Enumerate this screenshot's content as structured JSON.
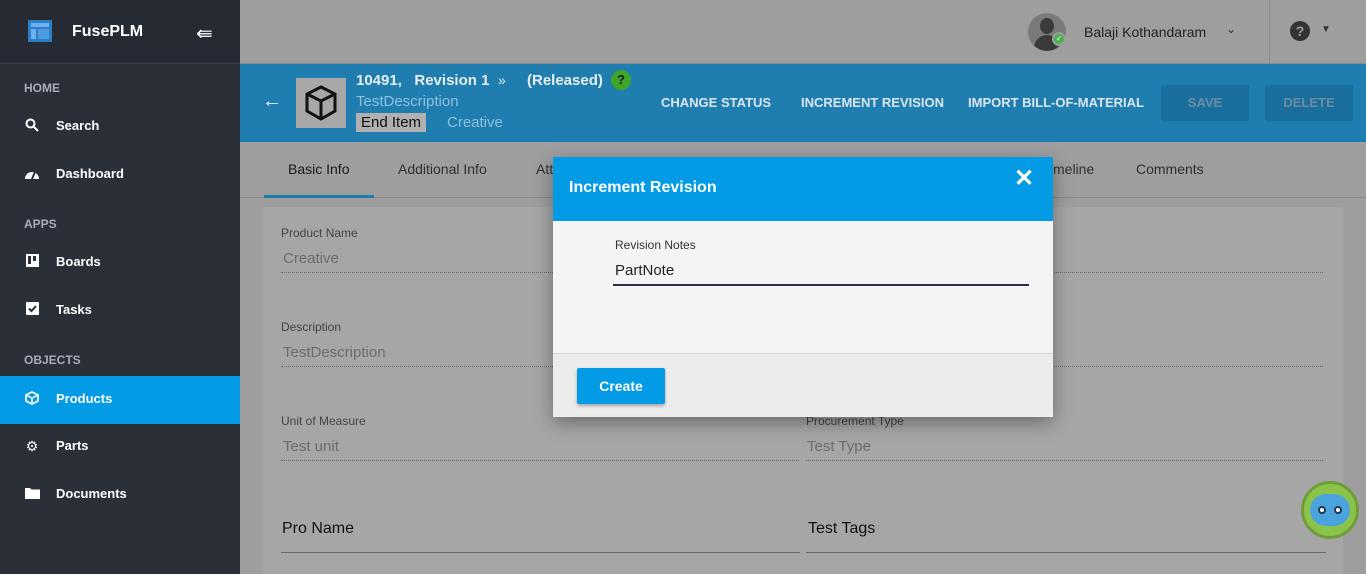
{
  "app": {
    "name": "FusePLM"
  },
  "sidebar": {
    "sections": {
      "home": "HOME",
      "apps": "APPS",
      "objects": "OBJECTS"
    },
    "items": [
      {
        "label": "Search",
        "icon": "search-icon"
      },
      {
        "label": "Dashboard",
        "icon": "dashboard-icon"
      },
      {
        "label": "Boards",
        "icon": "boards-icon"
      },
      {
        "label": "Tasks",
        "icon": "tasks-icon"
      },
      {
        "label": "Products",
        "icon": "cube-icon",
        "active": true
      },
      {
        "label": "Parts",
        "icon": "gear-icon"
      },
      {
        "label": "Documents",
        "icon": "folder-icon"
      }
    ]
  },
  "topbar": {
    "user_name": "Balaji Kothandaram"
  },
  "header": {
    "id_revision": "10491,   Revision 1",
    "status": "(Released)",
    "status_help": "?",
    "description": "TestDescription",
    "item_type": "End Item",
    "category": "Creative",
    "actions": {
      "change_status": "CHANGE STATUS",
      "increment_revision": "INCREMENT REVISION",
      "import_bom": "IMPORT BILL-OF-MATERIAL",
      "save": "SAVE",
      "delete": "DELETE"
    }
  },
  "tabs": [
    {
      "label": "Basic Info",
      "active": true
    },
    {
      "label": "Additional Info"
    },
    {
      "label": "Att"
    },
    {
      "label": "meline"
    },
    {
      "label": "Comments"
    }
  ],
  "form": {
    "product_name": {
      "label": "Product Name",
      "value": "Creative"
    },
    "description": {
      "label": "Description",
      "value": "TestDescription"
    },
    "unit_of_measure": {
      "label": "Unit of Measure",
      "value": "Test unit"
    },
    "procurement_type": {
      "label": "Procurement Type",
      "value": "Test Type"
    },
    "pro_name": {
      "value": "Pro Name"
    },
    "test_tags": {
      "value": "Test Tags"
    }
  },
  "modal": {
    "title": "Increment Revision",
    "close": "✕",
    "notes_label": "Revision Notes",
    "notes_value": "PartNote",
    "create_label": "Create"
  },
  "colors": {
    "accent": "#039be5",
    "header": "#1f7db0",
    "sidebar": "#2b2f38",
    "success": "#4caf50"
  }
}
